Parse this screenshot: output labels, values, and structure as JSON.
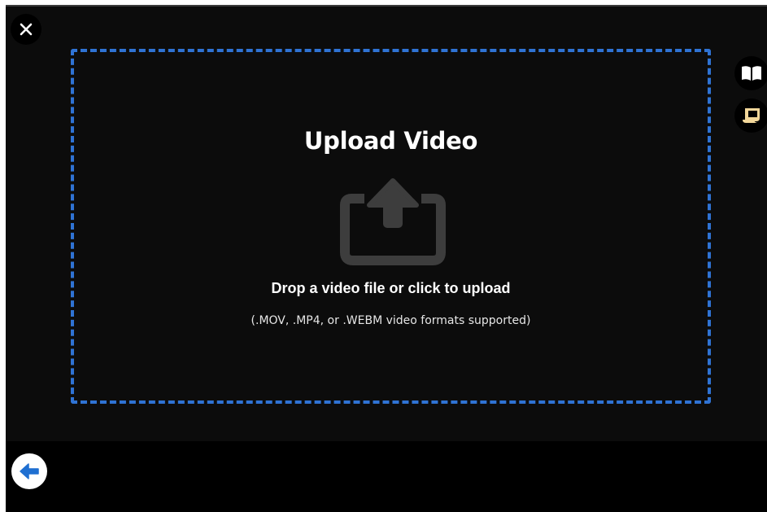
{
  "upload": {
    "title": "Upload Video",
    "instruction": "Drop a video file or click to upload",
    "formats": "(.MOV, .MP4, or .WEBM video formats supported)"
  },
  "icons": {
    "close": "close-icon",
    "upload": "upload-icon",
    "book": "book-icon",
    "note": "note-icon",
    "back": "back-arrow-icon"
  },
  "colors": {
    "background": "#0c0c0c",
    "dropzone_border": "#2f73d4",
    "upload_icon": "#3d3d3d",
    "note_icon": "#f2d79a",
    "back_arrow": "#1f6fd1"
  }
}
